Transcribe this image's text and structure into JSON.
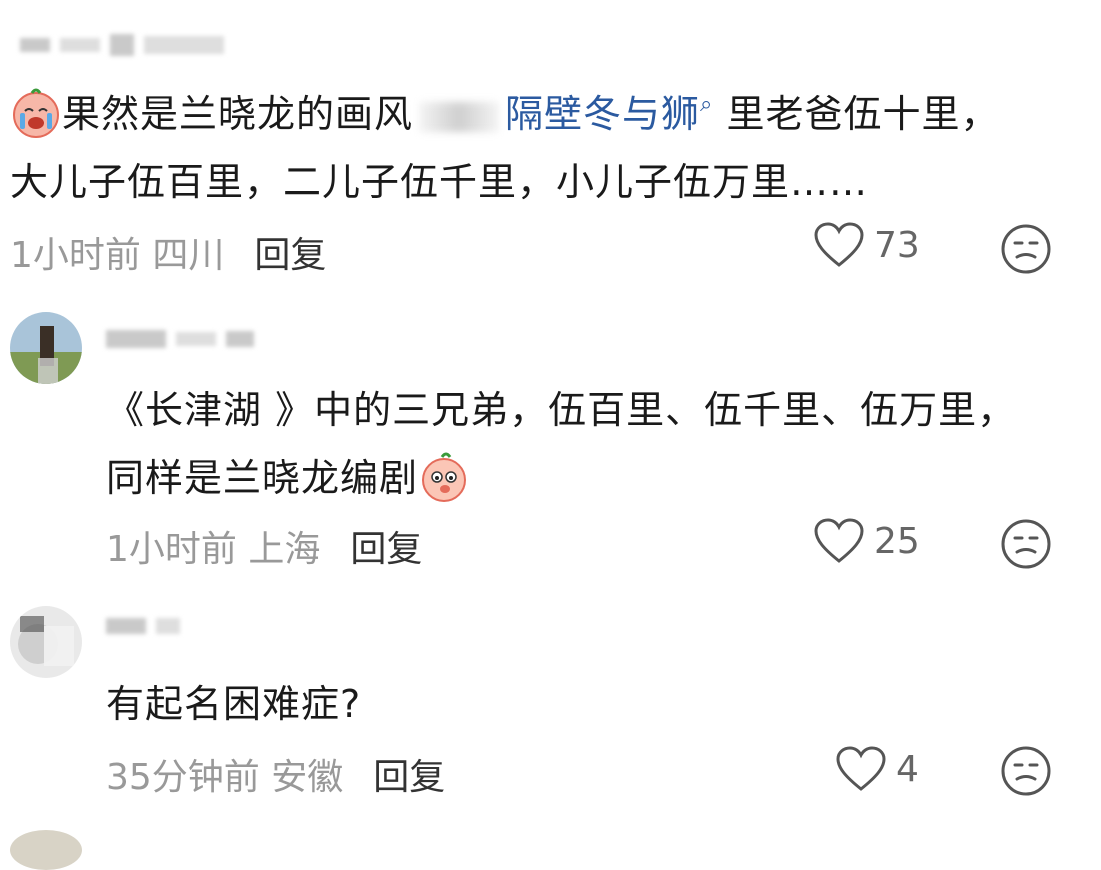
{
  "comments": [
    {
      "text_line1_a": "果然是兰晓龙的画风",
      "topic": "隔壁冬与狮",
      "text_line1_b": " 里老爸伍十里，",
      "text_line2": "大儿子伍百里，二儿子伍千里，小儿子伍万里……",
      "time_location": "1小时前 四川",
      "reply_label": "回复",
      "likes": "73"
    },
    {
      "text_line1": "《长津湖 》中的三兄弟，伍百里、伍千里、伍万里，",
      "text_line2": "同样是兰晓龙编剧",
      "time_location": "1小时前 上海",
      "reply_label": "回复",
      "likes": "25"
    },
    {
      "text_line1": "有起名困难症?",
      "time_location": "35分钟前 安徽",
      "reply_label": "回复",
      "likes": "4"
    }
  ],
  "colors": {
    "topic": "#2b5aa0",
    "meta": "#999999",
    "text": "#1a1a1a"
  }
}
